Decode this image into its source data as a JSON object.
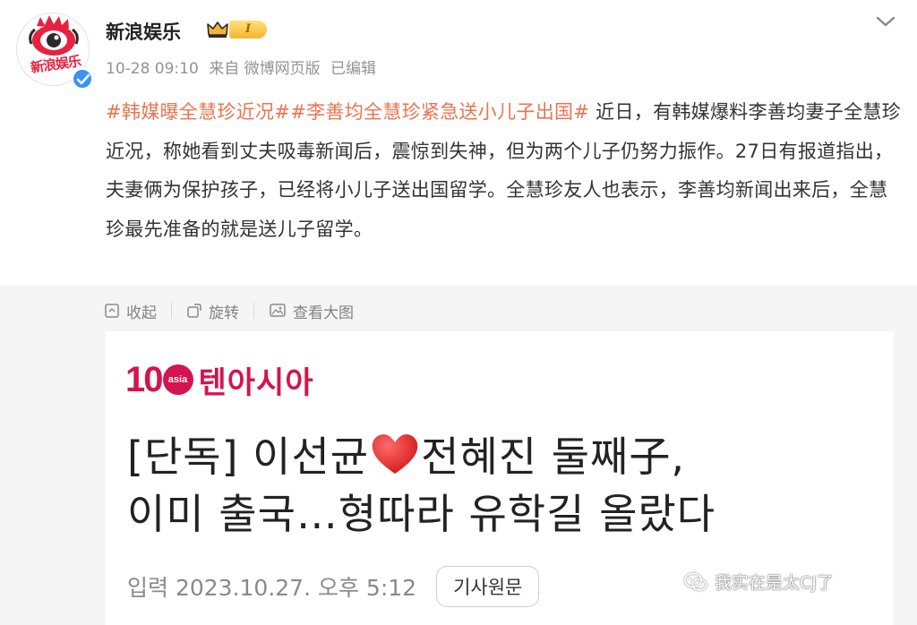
{
  "post": {
    "author": "新浪娱乐",
    "avatar_text": "新浪娱乐",
    "level_badge": "I",
    "time": "10-28 09:10",
    "source": "来自 微博网页版",
    "edited": "已编辑",
    "hashtag1": "#韩媒曝全慧珍近况#",
    "hashtag2": "#李善均全慧珍紧急送小儿子出国#",
    "body_text": " 近日，有韩媒爆料李善均妻子全慧珍近况，称她看到丈夫吸毒新闻后，震惊到失神，但为两个儿子仍努力振作。27日有报道指出，夫妻俩为保护孩子，已经将小儿子送出国留学。全慧珍友人也表示，李善均新闻出来后，全慧珍最先准备的就是送儿子留学。"
  },
  "media_toolbar": {
    "collapse_label": "收起",
    "rotate_label": "旋转",
    "view_large_label": "查看大图"
  },
  "article_image": {
    "logo_number": "10",
    "logo_circle": "asia",
    "logo_name": "텐아시아",
    "headline_part1": "[단독] 이선균",
    "headline_part2": "전혜진 둘째子,",
    "headline_line2": "이미 출국…형따라 유학길 올랐다",
    "input_date": "입력 2023.10.27. 오후 5:12",
    "source_button": "기사원문"
  },
  "watermark": {
    "text": "我实在是太CJ了"
  },
  "colors": {
    "hashtag": "#eb7350",
    "verified": "#3a93f0",
    "brand": "#d4144e"
  }
}
